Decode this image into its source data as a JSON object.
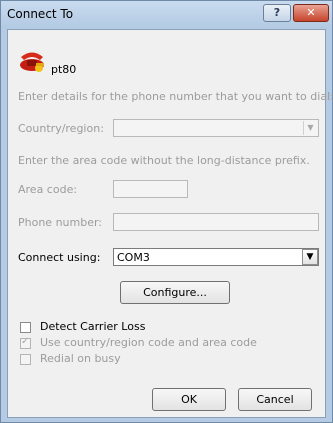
{
  "window": {
    "title": "Connect To",
    "help_label": "?",
    "close_label": "✕"
  },
  "connection": {
    "name": "pt80",
    "icon": "phone-icon"
  },
  "instructions": {
    "phone": "Enter details for the phone number that you want to dial:",
    "area": "Enter the area code without the long-distance prefix."
  },
  "fields": {
    "country_label": "Country/region:",
    "country_value": "",
    "area_label": "Area code:",
    "area_value": "",
    "phone_label": "Phone number:",
    "phone_value": "",
    "connect_label": "Connect using:",
    "connect_value": "COM3"
  },
  "buttons": {
    "configure": "Configure...",
    "ok": "OK",
    "cancel": "Cancel"
  },
  "checkboxes": {
    "detect_carrier": {
      "label": "Detect Carrier Loss",
      "checked": false,
      "enabled": true
    },
    "use_country": {
      "label": "Use country/region code and area code",
      "checked": true,
      "enabled": false
    },
    "redial": {
      "label": "Redial on busy",
      "checked": false,
      "enabled": false
    }
  }
}
